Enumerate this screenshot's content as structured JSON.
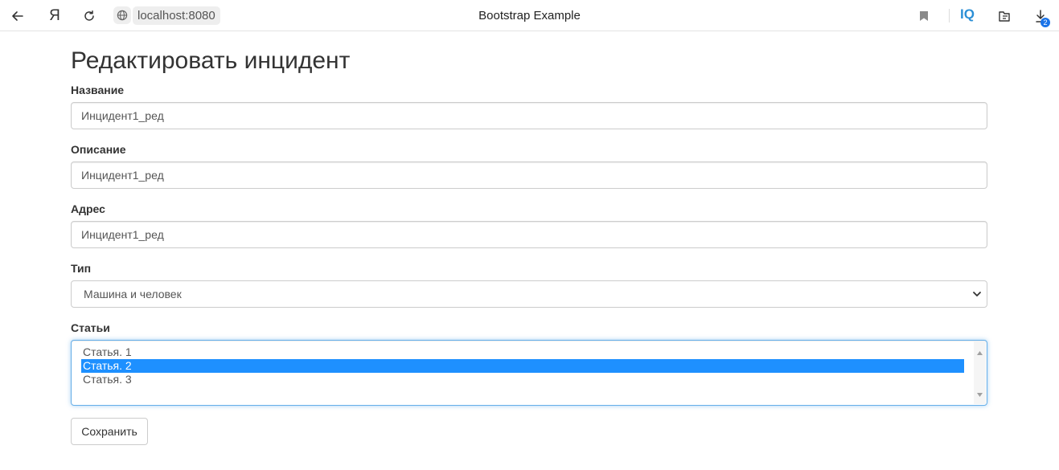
{
  "browser": {
    "tab_title": "Bootstrap Example",
    "address": "localhost:8080",
    "yandex_label": "Я",
    "iq_label": "IQ",
    "downloads_badge": "2",
    "icons": [
      "back-icon",
      "yandex-icon",
      "reload-icon",
      "globe-icon",
      "bookmark-icon",
      "iq-icon",
      "collections-icon",
      "downloads-icon"
    ]
  },
  "page": {
    "heading": "Редактировать инцидент",
    "fields": {
      "name": {
        "label": "Название",
        "value": "Инцидент1_ред"
      },
      "description": {
        "label": "Описание",
        "value": "Инцидент1_ред"
      },
      "address": {
        "label": "Адрес",
        "value": "Инцидент1_ред"
      },
      "type": {
        "label": "Тип",
        "selected": "Машина и человек"
      },
      "articles": {
        "label": "Статьи",
        "options": [
          "Статья. 1",
          "Статья. 2",
          "Статья. 3"
        ],
        "selected_index": 1
      }
    },
    "save_label": "Сохранить"
  },
  "colors": {
    "selected_option_bg": "#1e90ff",
    "focus_border": "#66afe9",
    "iq_blue": "#2b8fd6"
  }
}
